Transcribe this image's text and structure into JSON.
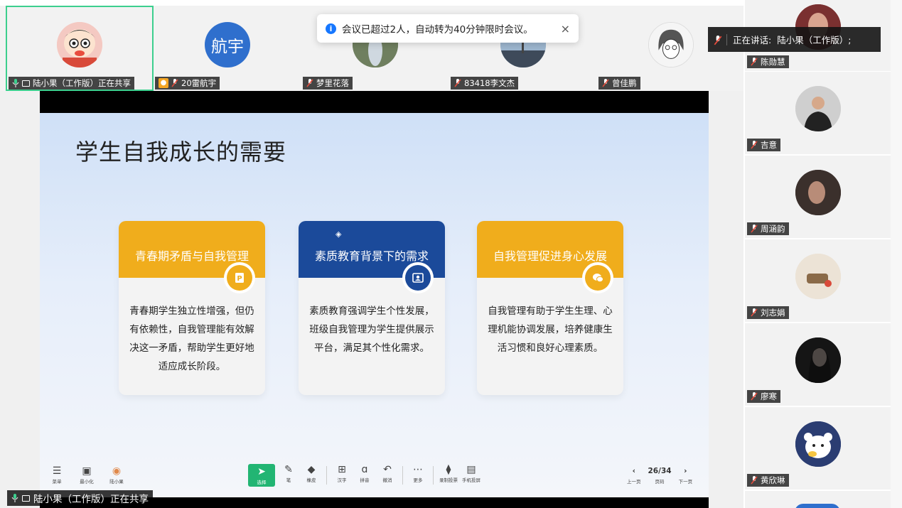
{
  "notification": {
    "text": "会议已超过2人，自动转为40分钟限时会议。",
    "close": "×"
  },
  "speaking": {
    "prefix": "正在讲话:",
    "names": "陆小果（工作版）;"
  },
  "top_tiles": [
    {
      "name": "陆小果（工作版）正在共享",
      "avatar": "cartoon"
    },
    {
      "name": "20雷航宇",
      "avatar_text": "航宇"
    },
    {
      "name": "梦里花落"
    },
    {
      "name": "83418李文杰"
    },
    {
      "name": "曾佳鹏"
    }
  ],
  "side_tiles": [
    {
      "name": "陈勋慧"
    },
    {
      "name": "吉意"
    },
    {
      "name": "周涵韵"
    },
    {
      "name": "刘志娟"
    },
    {
      "name": "廖寒"
    },
    {
      "name": "黄欣琳"
    }
  ],
  "slide": {
    "title": "学生自我成长的需要",
    "cards": [
      {
        "title": "青春期矛盾与自我管理",
        "body": "青春期学生独立性增强，但仍有依赖性，自我管理能有效解决这一矛盾，帮助学生更好地适应成长阶段。",
        "color": "#f0ad1c"
      },
      {
        "title": "素质教育背景下的需求",
        "body": "素质教育强调学生个性发展，班级自我管理为学生提供展示平台，满足其个性化需求。",
        "color": "#1b4a9a"
      },
      {
        "title": "自我管理促进身心发展",
        "body": "自我管理有助于学生生理、心理机能协调发展，培养健康生活习惯和良好心理素质。",
        "color": "#f0ad1c"
      }
    ]
  },
  "toolbar": {
    "menu": "菜单",
    "minimize": "最小化",
    "user": "陆小果",
    "select": "选择",
    "pen": "笔",
    "eraser": "橡皮",
    "hanzi": "汉字",
    "pinyin": "拼音",
    "undo": "撤消",
    "more": "更多",
    "record": "录制投票",
    "phone": "手机投屏",
    "prev": "上一页",
    "page_label": "页码",
    "page": "26/34",
    "next": "下一页"
  },
  "share_label": "陆小果（工作版）正在共享",
  "colors": {
    "accent_green": "#3ccf8e",
    "orange": "#f0ad1c",
    "navy": "#1b4a9a"
  }
}
